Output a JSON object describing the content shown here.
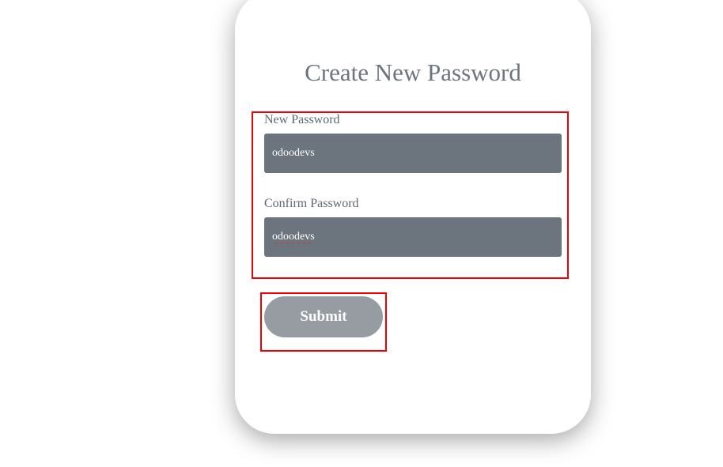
{
  "form": {
    "title": "Create New Password",
    "new_password": {
      "label": "New Password",
      "value": "odoodevs"
    },
    "confirm_password": {
      "label": "Confirm Password",
      "value": "odoodevs"
    },
    "submit_label": "Submit"
  },
  "colors": {
    "input_background": "#6c757d",
    "button_background": "#979ca3",
    "highlight_border": "#f00000",
    "title_text": "#6c757d"
  }
}
